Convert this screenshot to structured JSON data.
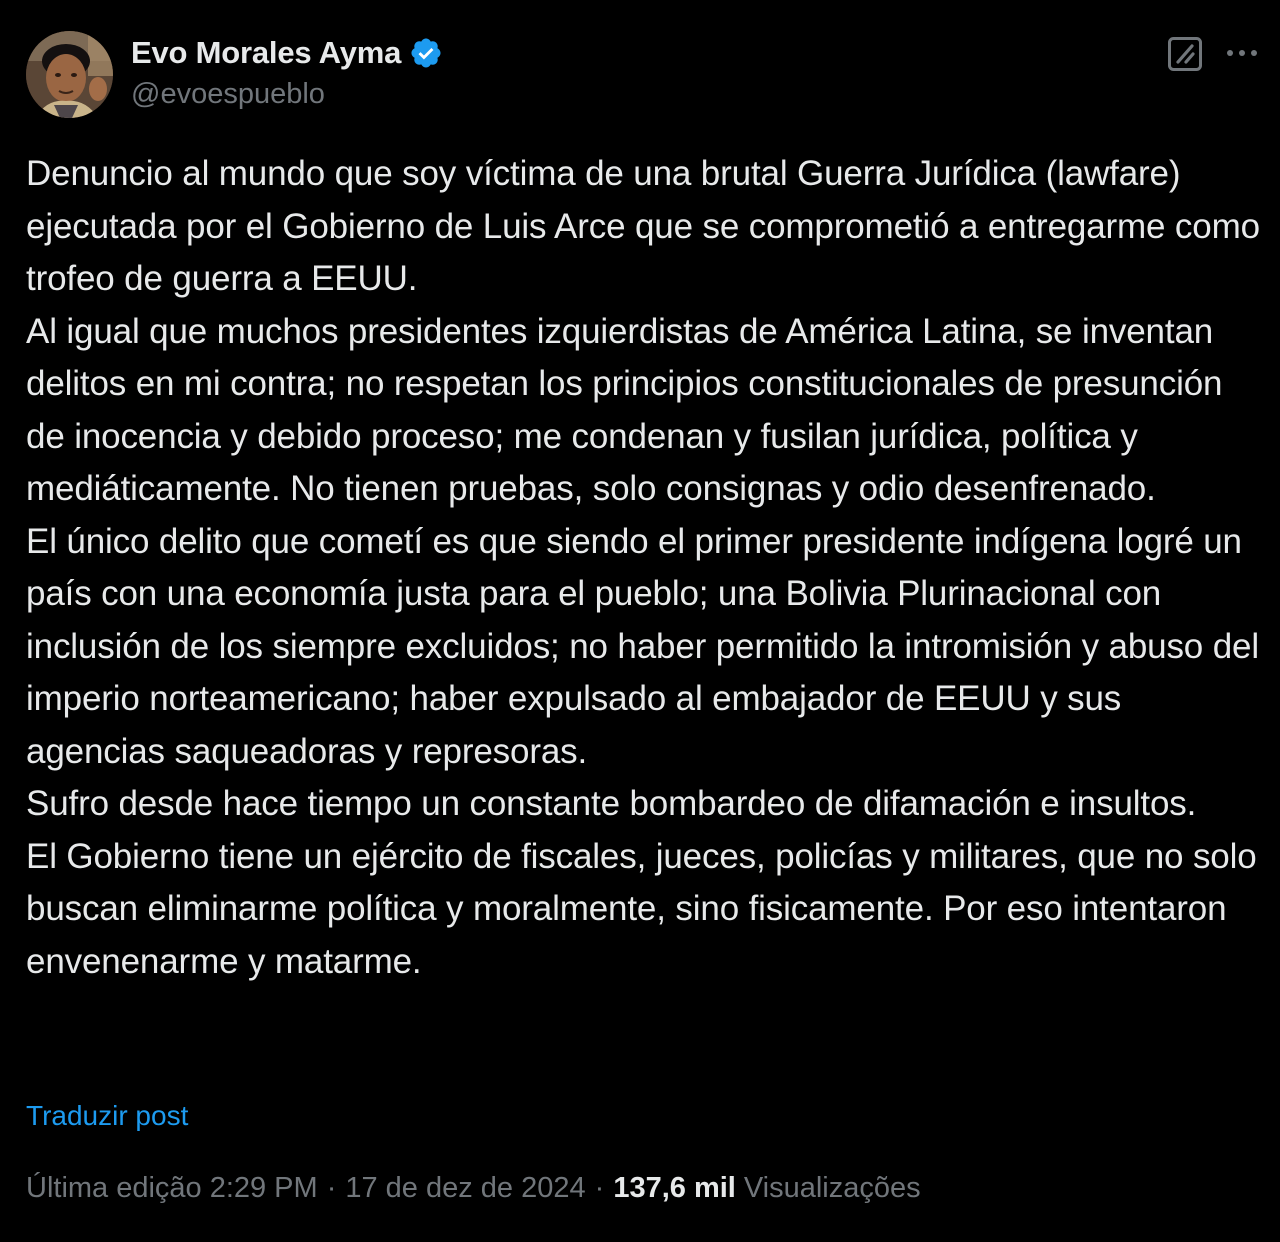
{
  "author": {
    "display_name": "Evo Morales Ayma",
    "handle": "@evoespueblo",
    "verified": true,
    "avatar_icon": "profile-photo"
  },
  "actions": {
    "grok_icon": "grok-icon",
    "more_icon": "more-icon"
  },
  "post": {
    "paragraphs": [
      "Denuncio al mundo que soy víctima de una brutal Guerra Jurídica (lawfare) ejecutada por el Gobierno de Luis Arce que se comprometió a entregarme como trofeo de guerra a EEUU.",
      "Al igual que muchos presidentes izquierdistas de América Latina, se inventan delitos en mi contra; no respetan los principios constitucionales de presunción de inocencia y debido proceso; me condenan y fusilan jurídica, política y mediáticamente. No tienen pruebas, solo consignas y odio desenfrenado.",
      "El único delito que cometí es que siendo el primer presidente indígena logré un país con una economía justa para el pueblo; una Bolivia Plurinacional con inclusión de los siempre excluidos; no haber permitido la intromisión y abuso del imperio norteamericano; haber expulsado al embajador de EEUU y sus agencias  saqueadoras y represoras.",
      "Sufro desde hace tiempo un constante bombardeo de difamación e insultos.",
      "El Gobierno tiene un ejército de fiscales, jueces, policías y militares, que no solo buscan eliminarme política y moralmente, sino fisicamente. Por eso intentaron envenenarme y matarme."
    ],
    "translate_label": "Traduzir post"
  },
  "meta": {
    "edited_label": "Última edição",
    "time": "2:29 PM",
    "separator": "·",
    "date": "17 de dez de 2024",
    "views_count": "137,6 mil",
    "views_label": "Visualizações"
  },
  "colors": {
    "background": "#000000",
    "text_primary": "#e7e9ea",
    "text_secondary": "#71767b",
    "link": "#1d9bf0",
    "verified": "#1d9bf0"
  }
}
